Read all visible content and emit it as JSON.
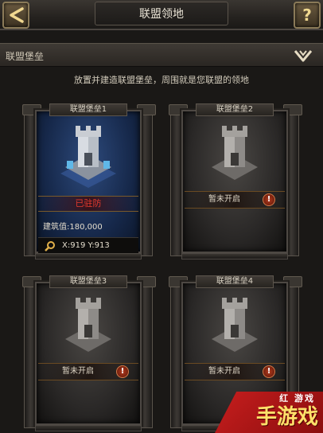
{
  "header": {
    "title": "联盟领地",
    "help_label": "?"
  },
  "section": {
    "label": "联盟堡垒"
  },
  "hint": "放置并建造联盟堡垒，周围就是您联盟的领地",
  "fortresses": [
    {
      "title": "联盟堡垒1",
      "status": "已驻防",
      "build_value": "建筑值:180,000",
      "coords": "X:919 Y:913"
    },
    {
      "title": "联盟堡垒2",
      "status": "暂未开启"
    },
    {
      "title": "联盟堡垒3",
      "status": "暂未开启"
    },
    {
      "title": "联盟堡垒4",
      "status": "暂未开启"
    }
  ],
  "warning_glyph": "!",
  "watermark": {
    "main": "手游戏",
    "sub": "红 游戏"
  },
  "colors": {
    "active_card_bg": "#16284a",
    "status_red": "#e43a2e",
    "watermark_red": "#c81e1e",
    "watermark_text": "#ffe06a"
  }
}
